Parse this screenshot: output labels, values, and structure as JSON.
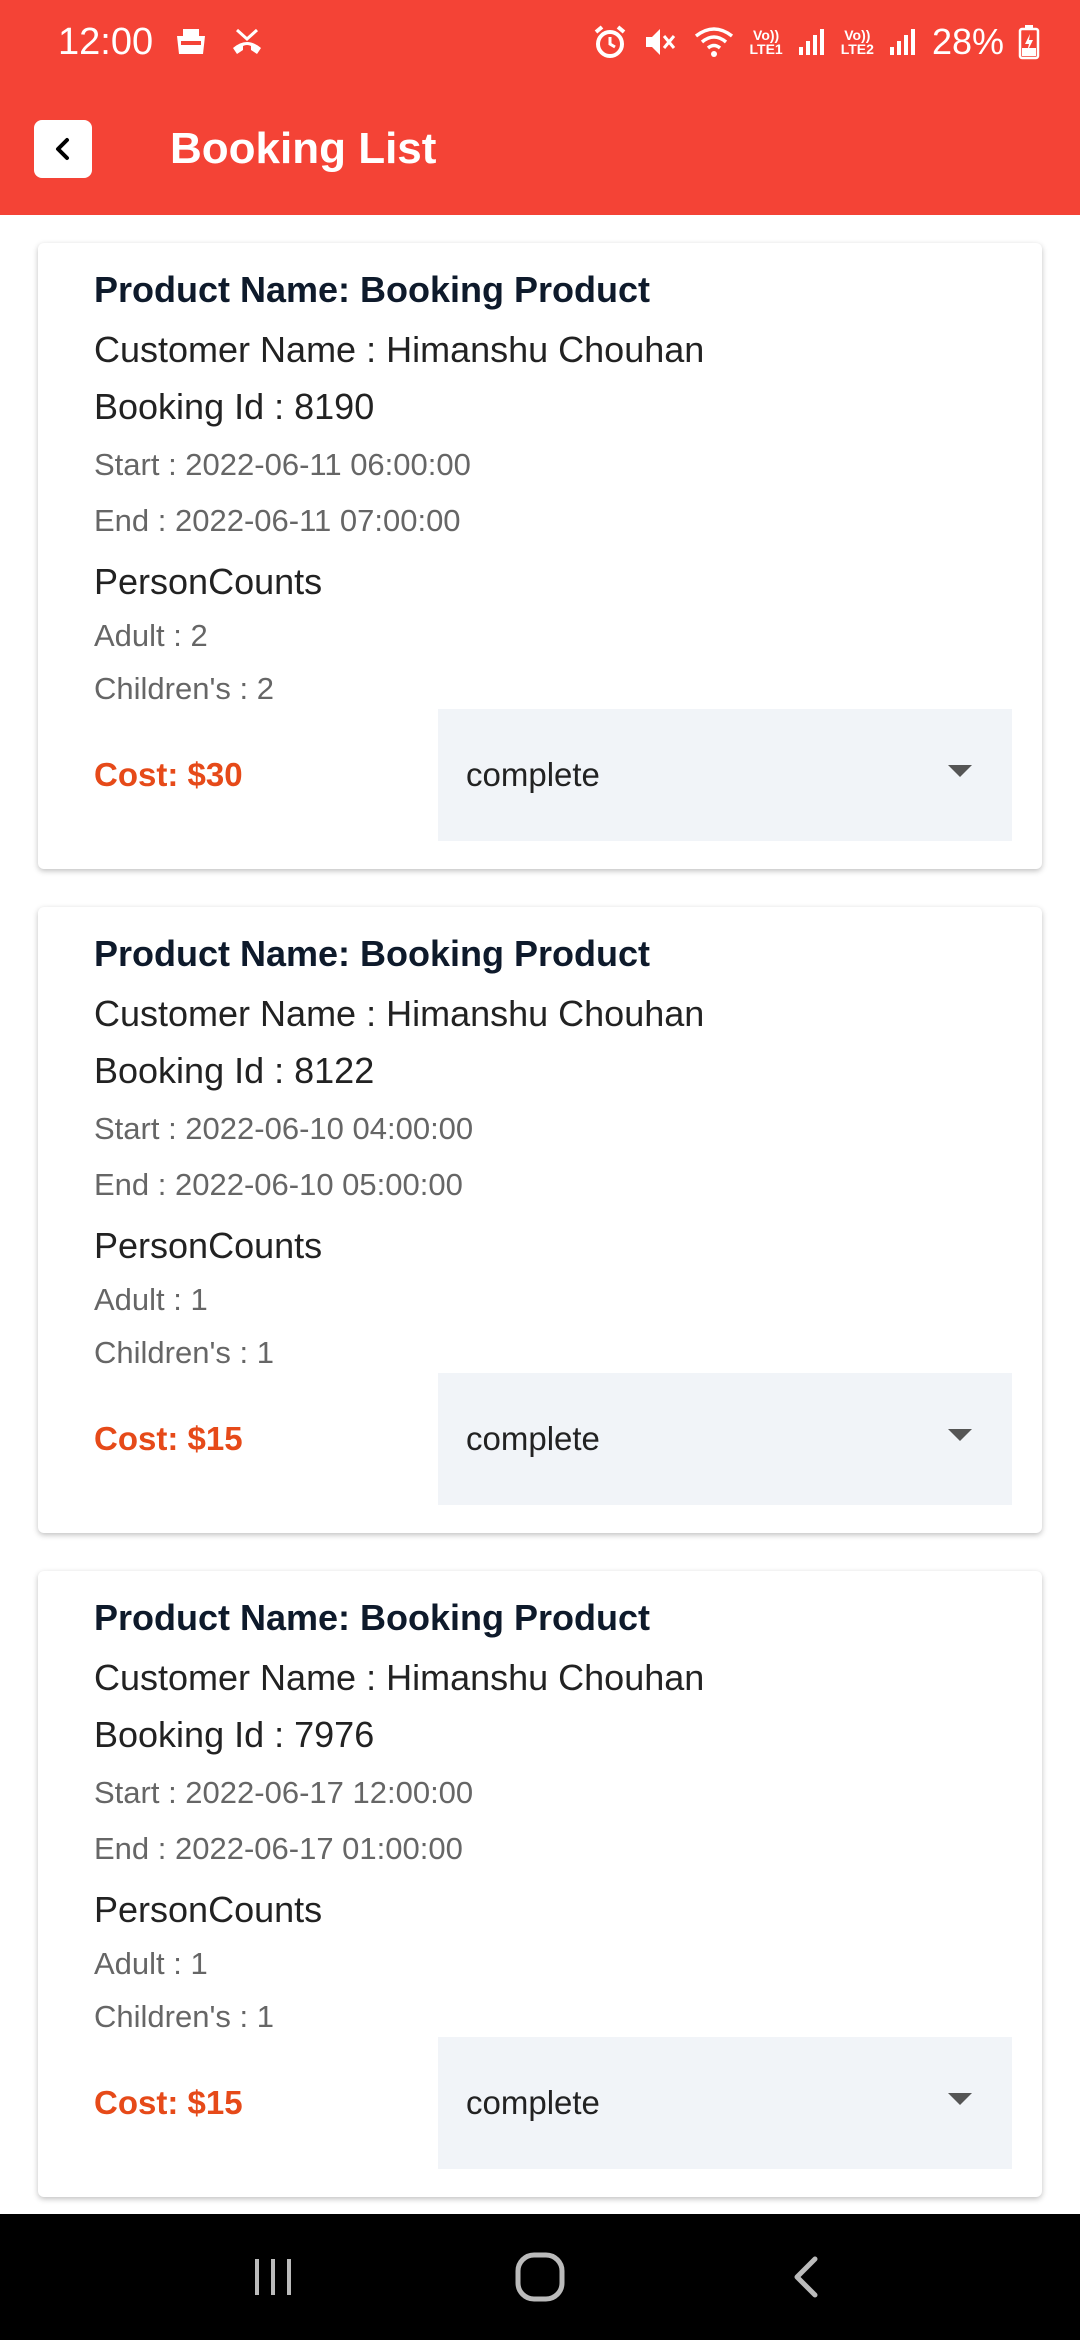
{
  "status_bar": {
    "time": "12:00",
    "battery": "28%",
    "sim1": "LTE1",
    "sim2": "LTE2",
    "volte": "Vo))",
    "icons": [
      "notification-icon",
      "missed-call-icon",
      "alarm-icon",
      "mute-icon",
      "wifi-icon",
      "signal-icon",
      "battery-icon"
    ]
  },
  "app_bar": {
    "title": "Booking List",
    "color": "#f44336"
  },
  "labels": {
    "person_counts": "PersonCounts"
  },
  "bookings": [
    {
      "product": "Product Name: Booking Product",
      "customer": "Customer Name : Himanshu Chouhan",
      "booking_id": "Booking Id : 8190",
      "start": "Start : 2022-06-11 06:00:00",
      "end": "End : 2022-06-11 07:00:00",
      "adult": "Adult : 2",
      "children": "Children's : 2",
      "cost": "Cost: $30",
      "status": "complete"
    },
    {
      "product": "Product Name: Booking Product",
      "customer": "Customer Name : Himanshu Chouhan",
      "booking_id": "Booking Id : 8122",
      "start": "Start : 2022-06-10 04:00:00",
      "end": "End : 2022-06-10 05:00:00",
      "adult": "Adult : 1",
      "children": "Children's : 1",
      "cost": "Cost: $15",
      "status": "complete"
    },
    {
      "product": "Product Name: Booking Product",
      "customer": "Customer Name : Himanshu Chouhan",
      "booking_id": "Booking Id : 7976",
      "start": "Start : 2022-06-17 12:00:00",
      "end": "End : 2022-06-17 01:00:00",
      "adult": "Adult : 1",
      "children": "Children's : 1",
      "cost": "Cost: $15",
      "status": "complete"
    }
  ],
  "nav_bar": {
    "icons": [
      "recent-apps-icon",
      "home-icon",
      "back-icon"
    ]
  }
}
